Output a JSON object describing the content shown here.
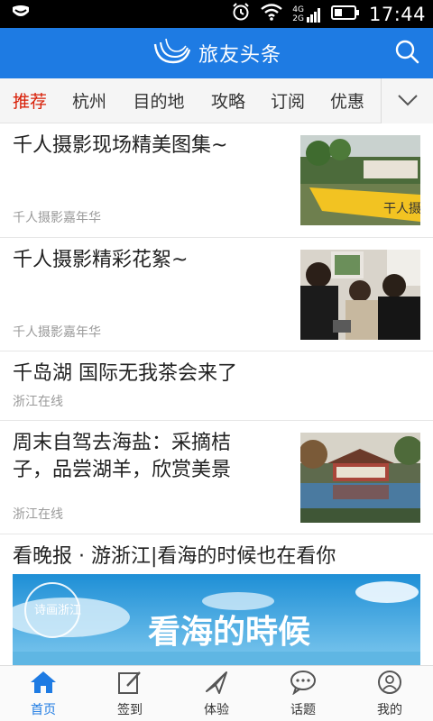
{
  "status_bar": {
    "time": "17:44",
    "signal_label_top": "4G",
    "signal_label_bottom": "2G"
  },
  "header": {
    "title": "旅友头条"
  },
  "tabs": [
    {
      "label": "推荐",
      "active": true
    },
    {
      "label": "杭州"
    },
    {
      "label": "目的地"
    },
    {
      "label": "攻略"
    },
    {
      "label": "订阅"
    },
    {
      "label": "优惠"
    }
  ],
  "feed": [
    {
      "title": "千人摄影现场精美图集~",
      "source": "千人摄影嘉年华"
    },
    {
      "title": "千人摄影精彩花絮~",
      "source": "千人摄影嘉年华"
    },
    {
      "title": "千岛湖 国际无我茶会来了",
      "source": "浙江在线"
    },
    {
      "title_line1": "周末自驾去海盐：采摘桔",
      "title_line2": "子，品尝湖羊，欣赏美景",
      "source": "浙江在线"
    },
    {
      "title": "看晚报 · 游浙江|看海的时候也在看你",
      "banner_text": "看海的時候",
      "banner_seal": "诗画浙江"
    }
  ],
  "thumb_texts": {
    "banner_photo_1": "干人摄"
  },
  "bottom_nav": [
    {
      "label": "首页",
      "icon": "home-icon",
      "active": true
    },
    {
      "label": "签到",
      "icon": "signin-icon"
    },
    {
      "label": "体验",
      "icon": "paper-plane-icon"
    },
    {
      "label": "话题",
      "icon": "chat-icon"
    },
    {
      "label": "我的",
      "icon": "profile-icon"
    }
  ],
  "colors": {
    "brand_blue": "#1e7be3",
    "active_tab_red": "#d81e06"
  }
}
